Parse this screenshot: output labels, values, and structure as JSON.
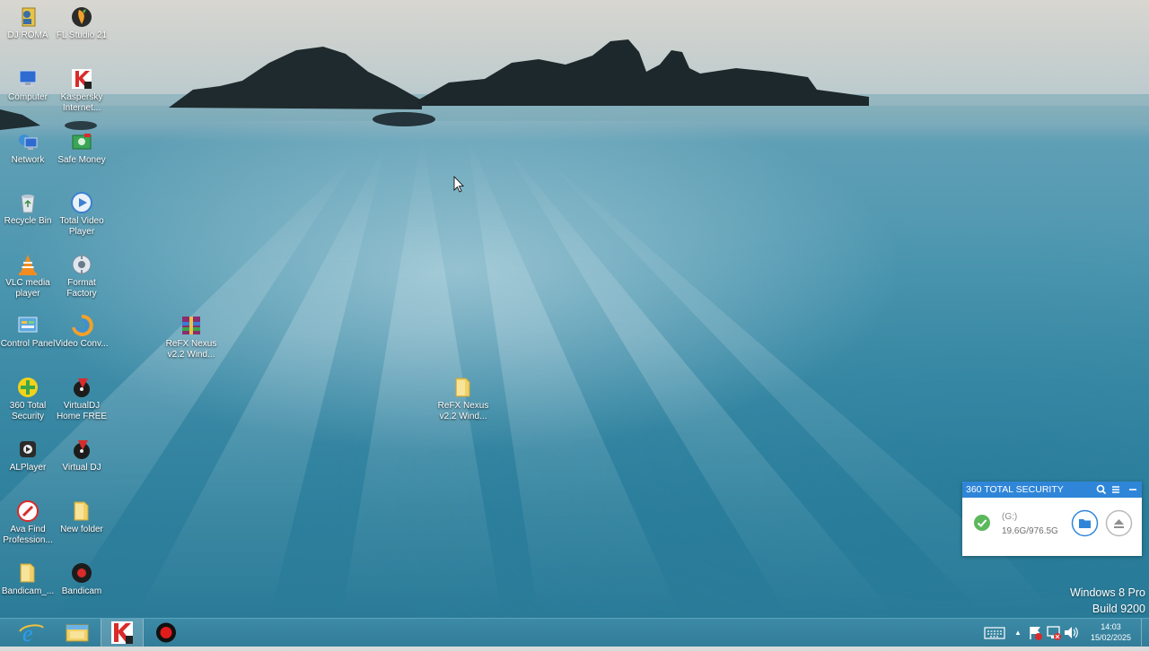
{
  "desktop": {
    "icons": [
      {
        "id": "dj-roma",
        "label": "DJ ROMA",
        "icon": "dj-user-icon"
      },
      {
        "id": "fl-studio",
        "label": "FL Studio 21",
        "icon": "fl-studio-icon"
      },
      {
        "id": "computer",
        "label": "Computer",
        "icon": "computer-icon"
      },
      {
        "id": "kaspersky",
        "label": "Kaspersky Internet...",
        "icon": "kaspersky-icon"
      },
      {
        "id": "network",
        "label": "Network",
        "icon": "network-icon"
      },
      {
        "id": "safe-money",
        "label": "Safe Money",
        "icon": "safe-money-icon"
      },
      {
        "id": "recycle-bin",
        "label": "Recycle Bin",
        "icon": "recycle-bin-icon"
      },
      {
        "id": "total-video-player",
        "label": "Total Video Player",
        "icon": "video-player-icon"
      },
      {
        "id": "vlc",
        "label": "VLC media player",
        "icon": "vlc-cone-icon"
      },
      {
        "id": "format-factory",
        "label": "Format Factory",
        "icon": "format-factory-icon"
      },
      {
        "id": "control-panel",
        "label": "Control Panel",
        "icon": "control-panel-icon"
      },
      {
        "id": "video-conv",
        "label": "Video Conv...",
        "icon": "video-converter-icon"
      },
      {
        "id": "360-total-security",
        "label": "360 Total Security",
        "icon": "360-security-icon"
      },
      {
        "id": "virtualdj-home",
        "label": "VirtualDJ Home FREE",
        "icon": "virtualdj-icon"
      },
      {
        "id": "alplayer",
        "label": "ALPlayer",
        "icon": "alplayer-icon"
      },
      {
        "id": "virtual-dj",
        "label": "Virtual DJ",
        "icon": "virtualdj-icon"
      },
      {
        "id": "ava-find",
        "label": "Ava Find Profession...",
        "icon": "ava-find-icon"
      },
      {
        "id": "new-folder",
        "label": "New folder",
        "icon": "folder-icon"
      },
      {
        "id": "bandicam-folder",
        "label": "Bandicam_...",
        "icon": "folder-icon"
      },
      {
        "id": "bandicam",
        "label": "Bandicam",
        "icon": "bandicam-icon"
      },
      {
        "id": "refx-rar",
        "label": "ReFX Nexus v2.2 Wind...",
        "icon": "winrar-archive-icon"
      },
      {
        "id": "refx-folder",
        "label": "ReFX Nexus v2.2 Wind...",
        "icon": "folder-icon"
      }
    ]
  },
  "watermark": {
    "line1": "Windows 8 Pro",
    "line2": "Build 9200"
  },
  "security_widget": {
    "title": "360 TOTAL SECURITY",
    "drive": "(G:)",
    "usage": "19.6G/976.5G",
    "status_color": "#5cb85c",
    "accent": "#2f86d8"
  },
  "taskbar": {
    "pinned": [
      {
        "name": "internet-explorer",
        "icon": "internet-explorer-icon"
      },
      {
        "name": "file-explorer",
        "icon": "file-explorer-icon"
      },
      {
        "name": "kaspersky",
        "icon": "kaspersky-icon",
        "active": true
      },
      {
        "name": "bandicam",
        "icon": "record-icon"
      }
    ],
    "tray": {
      "chevron": "▲"
    },
    "clock": {
      "time": "14:03",
      "date": "15/02/2025"
    }
  }
}
